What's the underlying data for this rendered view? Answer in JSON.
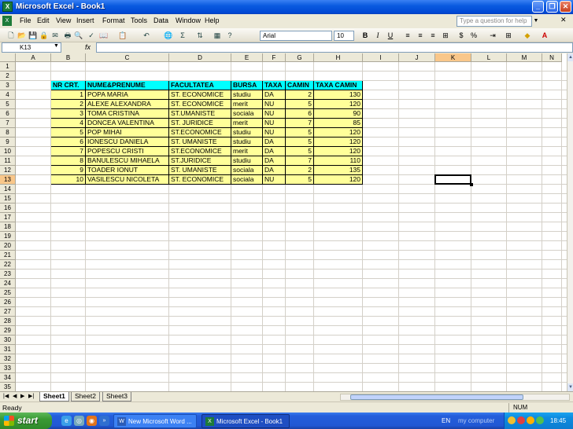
{
  "window": {
    "title": "Microsoft Excel - Book1",
    "app_icon_label": "X"
  },
  "title_buttons": {
    "minimize": "_",
    "maximize": "❐",
    "close": "✕"
  },
  "menu": [
    "File",
    "Edit",
    "View",
    "Insert",
    "Format",
    "Tools",
    "Data",
    "Window",
    "Help"
  ],
  "help_box": {
    "placeholder": "Type a question for help"
  },
  "toolbar": {
    "font_name": "Arial",
    "font_size": "10",
    "bold": "B",
    "italic": "I",
    "underline": "U",
    "autosum": "Σ",
    "percent": "%"
  },
  "formula_bar": {
    "name_box": "K13",
    "fx": "fx",
    "formula": ""
  },
  "grid": {
    "columns": [
      "A",
      "B",
      "C",
      "D",
      "E",
      "F",
      "G",
      "H",
      "I",
      "J",
      "K",
      "L",
      "M",
      "N"
    ],
    "selected_column": "K",
    "rows": [
      "1",
      "2",
      "3",
      "4",
      "5",
      "6",
      "7",
      "8",
      "9",
      "10",
      "11",
      "12",
      "13",
      "14",
      "15",
      "16",
      "17",
      "18",
      "19",
      "20",
      "21",
      "22",
      "23",
      "24",
      "25",
      "26",
      "27",
      "28",
      "29",
      "30",
      "31",
      "32",
      "33",
      "34",
      "35"
    ],
    "selected_row": "13",
    "selected_cell": "K13"
  },
  "table": {
    "headers": [
      "NR CRT.",
      "NUME&PRENUME",
      "FACULTATEA",
      "BURSA",
      "TAXA",
      "CAMIN",
      "TAXA CAMIN"
    ],
    "rows": [
      [
        "1",
        "POPA MARIA",
        "ST. ECONOMICE",
        "studiu",
        "DA",
        "2",
        "130"
      ],
      [
        "2",
        "ALEXE ALEXANDRA",
        "ST. ECONOMICE",
        "merit",
        "NU",
        "5",
        "120"
      ],
      [
        "3",
        "TOMA CRISTINA",
        "ST.UMANISTE",
        "sociala",
        "NU",
        "6",
        "90"
      ],
      [
        "4",
        "DONCEA VALENTINA",
        "ST. JURIDICE",
        "merit",
        "NU",
        "7",
        "85"
      ],
      [
        "5",
        "POP MIHAI",
        "ST.ECONOMICE",
        "studiu",
        "NU",
        "5",
        "120"
      ],
      [
        "6",
        "IONESCU DANIELA",
        "ST. UMANISTE",
        "studiu",
        "DA",
        "5",
        "120"
      ],
      [
        "7",
        "POPESCU CRISTI",
        "ST.ECONOMICE",
        "merit",
        "DA",
        "5",
        "120"
      ],
      [
        "8",
        "BANULESCU MIHAELA",
        "ST.JURIDICE",
        "studiu",
        "DA",
        "7",
        "110"
      ],
      [
        "9",
        "TOADER IONUT",
        "ST. UMANISTE",
        "sociala",
        "DA",
        "2",
        "135"
      ],
      [
        "10",
        "VASILESCU NICOLETA",
        "ST. ECONOMICE",
        "sociala",
        "NU",
        "5",
        "120"
      ]
    ]
  },
  "sheets": {
    "tabs": [
      "Sheet1",
      "Sheet2",
      "Sheet3"
    ],
    "active": "Sheet1"
  },
  "status": {
    "left": "Ready",
    "num": "NUM"
  },
  "taskbar": {
    "start": "start",
    "items": [
      {
        "label": "New Microsoft Word ...",
        "icon": "word-icon"
      },
      {
        "label": "Microsoft Excel - Book1",
        "icon": "excel-icon"
      }
    ],
    "lang": "EN",
    "my_computer": "my computer",
    "clock": "18:45"
  },
  "colors": {
    "header_fill": "#00ffff",
    "data_fill": "#ffff99",
    "selection_header": "#f9c78a"
  }
}
